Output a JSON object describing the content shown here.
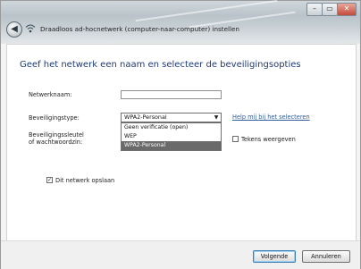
{
  "window": {
    "title": "Draadloos ad-hocnetwerk (computer-naar-computer) instellen",
    "controls": [
      "–",
      "▭",
      "✕"
    ]
  },
  "heading": "Geef het netwerk een naam en selecteer de beveiligingsopties",
  "form": {
    "network_name_label": "Netwerknaam:",
    "network_name_value": "",
    "security_type_label": "Beveiligingstype:",
    "security_type_selected": "WPA2-Personal",
    "security_type_options": [
      "Geen verificatie (open)",
      "WEP",
      "WPA2-Personal"
    ],
    "help_link": "Help mij bij het selecteren",
    "security_key_label_line1": "Beveiligingssleutel",
    "security_key_label_line2": "of wachtwoordzin:",
    "show_chars_label": "Tekens weergeven",
    "show_chars_checked": false,
    "save_network_label": "Dit netwerk opslaan",
    "save_network_checked": true
  },
  "buttons": {
    "next": "Volgende",
    "cancel": "Annuleren"
  },
  "icons": {
    "back": "back-arrow-icon",
    "wizard": "wireless-network-icon",
    "dropdown": "chevron-down-icon",
    "checkmark": "checkmark-icon"
  }
}
